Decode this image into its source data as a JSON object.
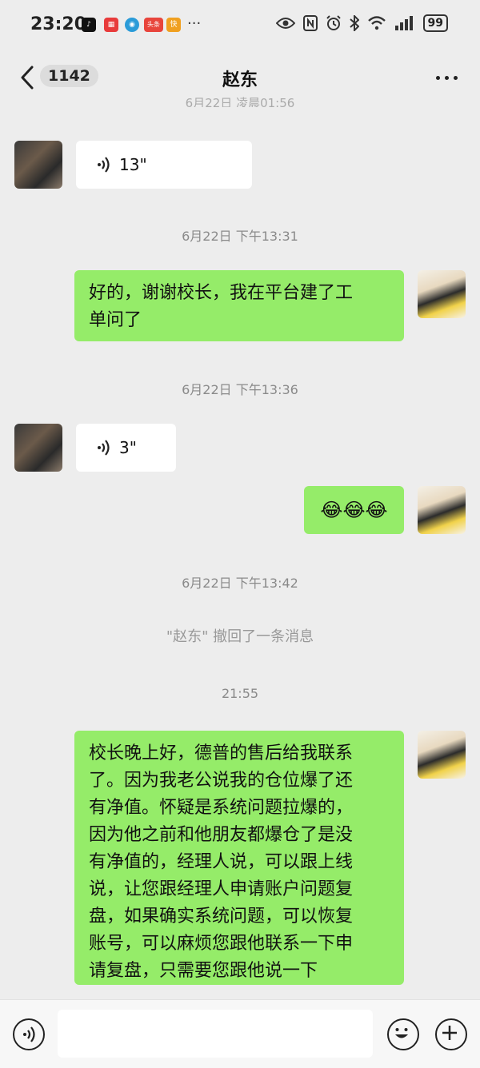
{
  "status_bar": {
    "time": "23:20",
    "battery": "99",
    "notifications": [
      {
        "name": "tiktok-icon",
        "color": "#111111",
        "glyph": "♪"
      },
      {
        "name": "huawei-app-icon",
        "color": "#e83b3b",
        "glyph": "▦"
      },
      {
        "name": "browser-icon",
        "color": "#2a9bd8",
        "glyph": "◉"
      },
      {
        "name": "toutiao-icon",
        "color": "#e8453c",
        "glyph": "头条"
      },
      {
        "name": "app-icon",
        "color": "#f0a020",
        "glyph": "快"
      }
    ],
    "more": "···"
  },
  "header": {
    "unread_count": "1142",
    "title": "赵东"
  },
  "partial_timestamp": "6月22日 凌晨01:56",
  "messages": [
    {
      "type": "voice",
      "side": "left",
      "duration": "13\""
    },
    {
      "type": "time",
      "text": "6月22日 下午13:31"
    },
    {
      "type": "text",
      "side": "right",
      "lines": [
        "好的，谢谢校长，我在平台建了工",
        "单问了"
      ]
    },
    {
      "type": "time",
      "text": "6月22日 下午13:36"
    },
    {
      "type": "voice",
      "side": "left",
      "duration": "3\""
    },
    {
      "type": "text",
      "side": "right",
      "emoji": "😂😂😂"
    },
    {
      "type": "time",
      "text": "6月22日 下午13:42"
    },
    {
      "type": "recall",
      "text": "\"赵东\" 撤回了一条消息"
    },
    {
      "type": "time",
      "text": "21:55"
    },
    {
      "type": "text",
      "side": "right",
      "lines": [
        "校长晚上好，德普的售后给我联系",
        "了。因为我老公说我的仓位爆了还",
        "有净值。怀疑是系统问题拉爆的，",
        "因为他之前和他朋友都爆仓了是没",
        "有净值的，经理人说，可以跟上线",
        "说，让您跟经理人申请账户问题复",
        "盘，如果确实系统问题，可以恢复",
        "账号，可以麻烦您跟他联系一下申",
        "请复盘，只需要您跟他说一下"
      ]
    }
  ],
  "input": {
    "value": "",
    "placeholder": ""
  },
  "colors": {
    "bubble_out": "#95ec69",
    "bubble_in": "#ffffff",
    "background": "#ededed"
  }
}
